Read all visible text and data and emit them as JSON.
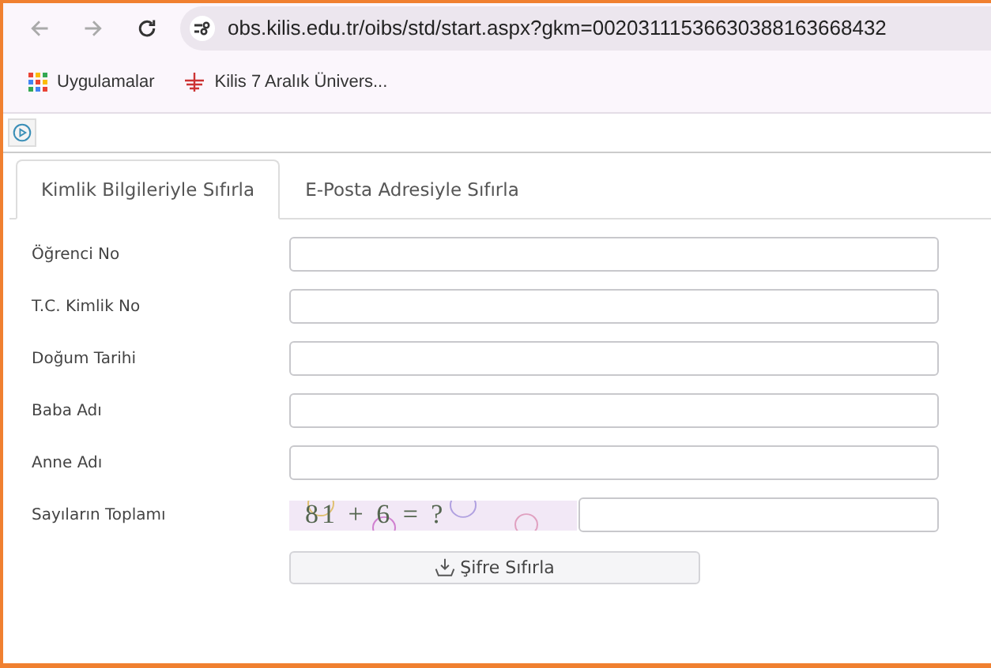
{
  "browser": {
    "url": "obs.kilis.edu.tr/oibs/std/start.aspx?gkm=00203111536630388163668432",
    "bookmarks": [
      {
        "kind": "apps",
        "label": "Uygulamalar"
      },
      {
        "kind": "site",
        "label": "Kilis 7 Aralık Ünivers..."
      }
    ]
  },
  "tabs": [
    {
      "label": "Kimlik Bilgileriyle Sıfırla",
      "selected": true
    },
    {
      "label": "E-Posta Adresiyle Sıfırla",
      "selected": false
    }
  ],
  "fields": [
    {
      "label": "Öğrenci No",
      "kind": "text"
    },
    {
      "label": "T.C. Kimlik No",
      "kind": "text"
    },
    {
      "label": "Doğum Tarihi",
      "kind": "text"
    },
    {
      "label": "Baba Adı",
      "kind": "text"
    },
    {
      "label": "Anne Adı",
      "kind": "text"
    },
    {
      "label": "Sayıların Toplamı",
      "kind": "captcha",
      "captcha": "81 + 6 = ?"
    }
  ],
  "submit": "Şifre Sıfırla"
}
